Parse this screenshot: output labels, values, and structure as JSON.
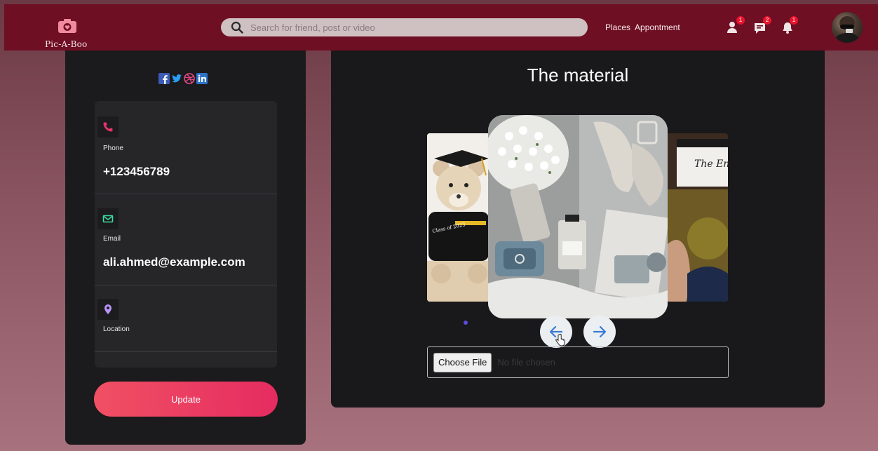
{
  "navbar": {
    "logo_text": "Pic-A-Boo",
    "search_placeholder": "Search for friend, post or video",
    "links": [
      "Places",
      "Appontment"
    ],
    "badges": {
      "friends": "1",
      "messages": "2",
      "notifications": "1"
    }
  },
  "profile": {
    "contacts": [
      {
        "icon": "phone-icon",
        "label": "Phone",
        "value": "+123456789",
        "color": "#e8336b"
      },
      {
        "icon": "mail-icon",
        "label": "Email",
        "value": "ali.ahmed@example.com",
        "color": "#3ddba0"
      },
      {
        "icon": "location-pin-icon",
        "label": "Location",
        "value": "",
        "color": "#b794f6"
      }
    ],
    "update_label": "Update"
  },
  "main": {
    "title": "The material",
    "file_input": {
      "button_label": "Choose File",
      "status_text": "No file chosen"
    }
  },
  "colors": {
    "navbar": "#6e0f24",
    "accent": "#e52c60",
    "panel": "#19181a"
  }
}
